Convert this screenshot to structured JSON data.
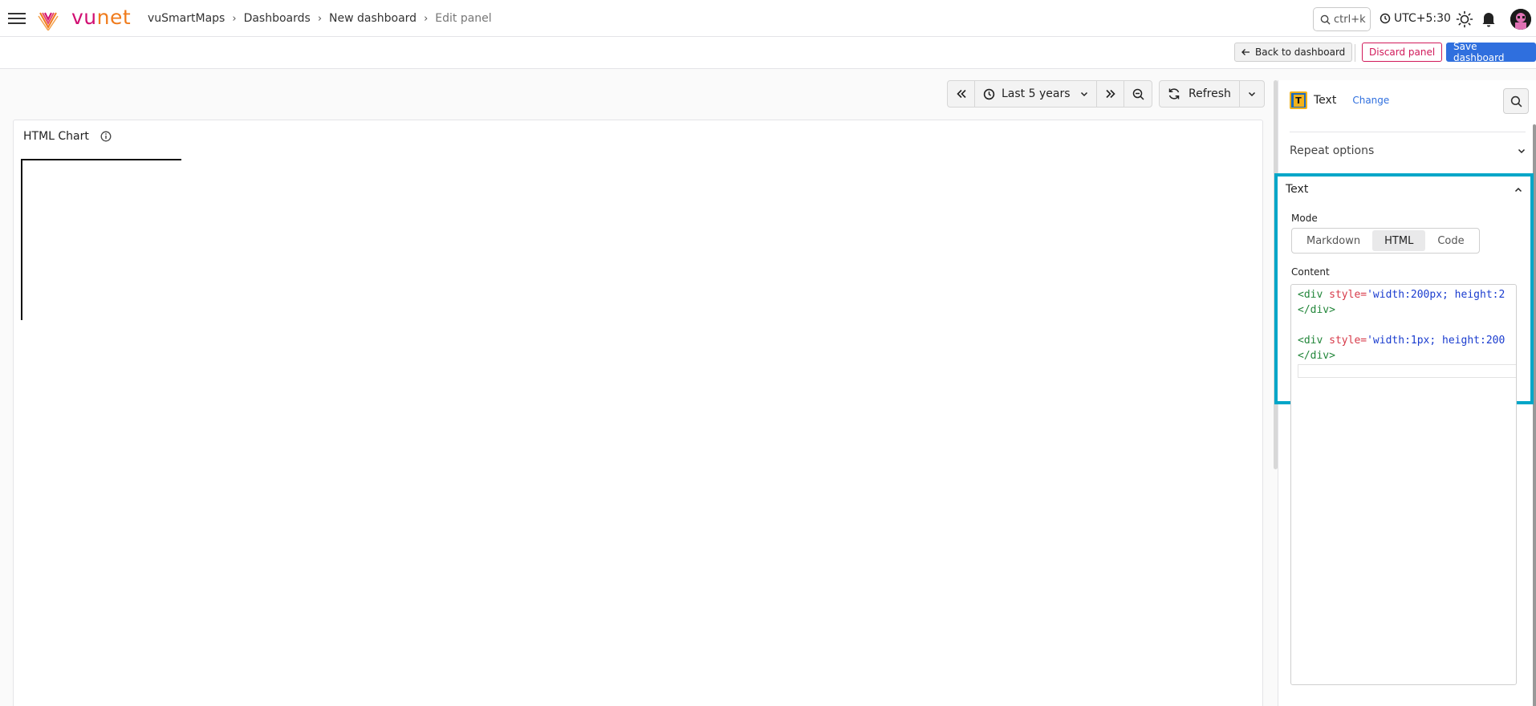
{
  "brand": {
    "logo_vu": "vu",
    "logo_net": "net"
  },
  "breadcrumb": [
    {
      "label": "vuSmartMaps"
    },
    {
      "label": "Dashboards"
    },
    {
      "label": "New dashboard"
    },
    {
      "label": "Edit panel"
    }
  ],
  "topbar": {
    "search_shortcut": "ctrl+k",
    "timezone": "UTC+5:30"
  },
  "actions": {
    "back": "Back to dashboard",
    "discard": "Discard panel",
    "save": "Save dashboard"
  },
  "time_controls": {
    "range": "Last 5 years",
    "refresh": "Refresh"
  },
  "panel": {
    "title": "HTML Chart"
  },
  "options": {
    "visualization": "Text",
    "change": "Change",
    "repeat_options": "Repeat options",
    "text_section": {
      "title": "Text",
      "mode_label": "Mode",
      "modes": [
        "Markdown",
        "HTML",
        "Code"
      ],
      "active_mode": "HTML",
      "content_label": "Content",
      "code_lines": [
        {
          "tag_open": "<div",
          "attr": " style=",
          "str": "'width:200px; height:2"
        },
        {
          "tag_close": "</div>"
        },
        {
          "blank": ""
        },
        {
          "tag_open": "<div",
          "attr": " style=",
          "str": "'width:1px; height:200"
        },
        {
          "tag_close": "</div>"
        }
      ]
    }
  },
  "colors": {
    "accent": "#2f6fde",
    "danger": "#d11a5a",
    "highlight": "#00a6c8",
    "brand_pink": "#d10f72",
    "brand_orange": "#f07b1c"
  }
}
